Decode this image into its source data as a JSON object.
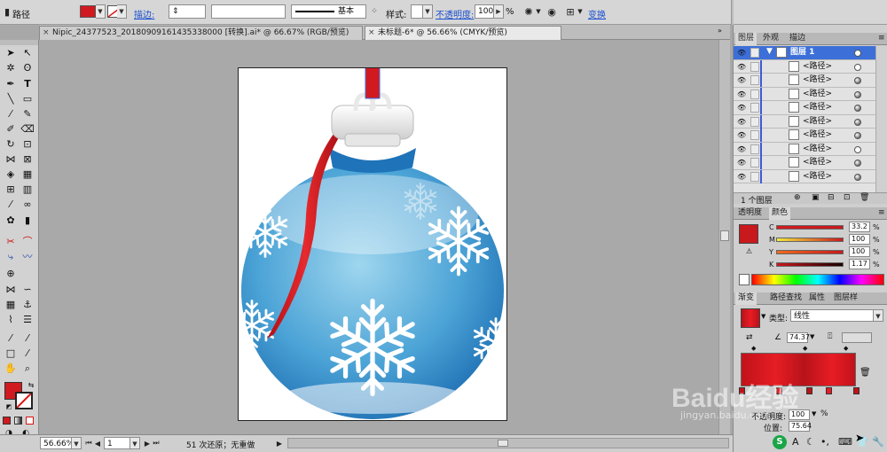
{
  "control_bar": {
    "object_label": "路径",
    "stroke_label": "描边:",
    "stroke_profile": "基本",
    "style_label": "样式:",
    "opacity_label": "不透明度:",
    "opacity_value": "100",
    "opacity_unit": "%",
    "transform_link": "变换",
    "fill_color": "#d11a1f"
  },
  "tabs": [
    {
      "label": "Nipic_24377523_20180909161435338000  [转换].ai* @ 66.67% (RGB/预览)",
      "active": false
    },
    {
      "label": "未标题-6* @ 56.66% (CMYK/预览)",
      "active": true
    }
  ],
  "status": {
    "zoom": "56.66%",
    "page": "1",
    "history": "51 次还原；无重做"
  },
  "layers_panel": {
    "tabs": [
      "图层",
      "外观",
      "描边"
    ],
    "top_layer": "图层 1",
    "items": [
      {
        "label": "<路径>",
        "target": "empty"
      },
      {
        "label": "<路径>",
        "target": "full"
      },
      {
        "label": "<路径>",
        "target": "full"
      },
      {
        "label": "<路径>",
        "target": "full"
      },
      {
        "label": "<路径>",
        "target": "full"
      },
      {
        "label": "<路径>",
        "target": "full"
      },
      {
        "label": "<路径>",
        "target": "empty"
      },
      {
        "label": "<路径>",
        "target": "full"
      },
      {
        "label": "<路径>",
        "target": "full"
      }
    ],
    "footer": "1 个图层"
  },
  "color_panel": {
    "tabs": [
      "透明度",
      "颜色"
    ],
    "channels": [
      {
        "name": "C",
        "value": "33.2"
      },
      {
        "name": "M",
        "value": "100"
      },
      {
        "name": "Y",
        "value": "100"
      },
      {
        "name": "K",
        "value": "1.17"
      }
    ],
    "swatch": "#c8191d"
  },
  "gradient_panel": {
    "tabs": [
      "渐变",
      "路径查找",
      "属性",
      "图层样"
    ],
    "type_label": "类型:",
    "type_value": "线性",
    "angle": "74.37",
    "opacity_label": "不透明度:",
    "opacity_value": "100",
    "opacity_unit": "%",
    "position_label": "位置:",
    "position_value": "75.64"
  },
  "watermark": {
    "brand": "Baidu经验",
    "url": "jingyan.baidu.com"
  }
}
